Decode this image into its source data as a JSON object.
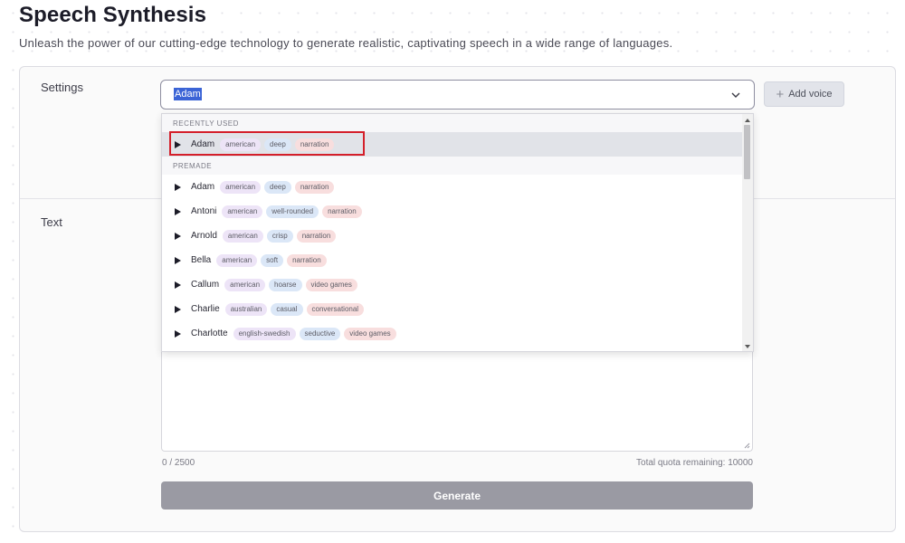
{
  "page": {
    "title": "Speech Synthesis",
    "subtitle": "Unleash the power of our cutting-edge technology to generate realistic, captivating speech in a wide range of languages."
  },
  "settings": {
    "label": "Settings",
    "selected_voice": "Adam",
    "add_voice_label": "Add voice"
  },
  "dropdown": {
    "groups": [
      {
        "label": "RECENTLY USED",
        "voices": [
          {
            "name": "Adam",
            "accent": "american",
            "description": "deep",
            "use_case": "narration",
            "active": true
          }
        ]
      },
      {
        "label": "PREMADE",
        "voices": [
          {
            "name": "Adam",
            "accent": "american",
            "description": "deep",
            "use_case": "narration"
          },
          {
            "name": "Antoni",
            "accent": "american",
            "description": "well-rounded",
            "use_case": "narration"
          },
          {
            "name": "Arnold",
            "accent": "american",
            "description": "crisp",
            "use_case": "narration"
          },
          {
            "name": "Bella",
            "accent": "american",
            "description": "soft",
            "use_case": "narration"
          },
          {
            "name": "Callum",
            "accent": "american",
            "description": "hoarse",
            "use_case": "video games"
          },
          {
            "name": "Charlie",
            "accent": "australian",
            "description": "casual",
            "use_case": "conversational"
          },
          {
            "name": "Charlotte",
            "accent": "english-swedish",
            "description": "seductive",
            "use_case": "video games"
          }
        ]
      }
    ]
  },
  "text": {
    "label": "Text",
    "char_count": "0 / 2500",
    "quota": "Total quota remaining: 10000"
  },
  "generate_label": "Generate",
  "colors": {
    "highlight": "#d41f2a",
    "selection": "#3b64d6",
    "generate_bg": "#9a9aa3"
  }
}
